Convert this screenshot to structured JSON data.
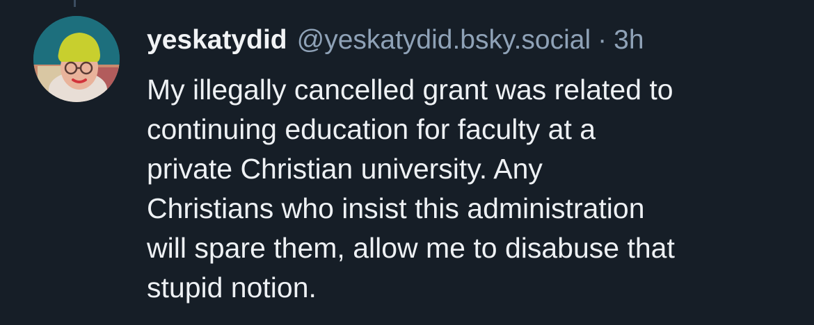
{
  "post": {
    "author": {
      "display_name": "yeskatydid",
      "handle": "@yeskatydid.bsky.social"
    },
    "separator": "·",
    "timestamp": "3h",
    "text": "My illegally cancelled grant was related to\ncontinuing education for faculty at a\nprivate Christian university. Any\nChristians who insist this administration\nwill spare them, allow me to disabuse that\nstupid notion."
  },
  "colors": {
    "background": "#161e27",
    "primary_text": "#eef1f4",
    "secondary_text": "#8fa2b7",
    "thread_line": "#3c4d60"
  },
  "icons": {
    "avatar": "user-avatar-photo"
  }
}
